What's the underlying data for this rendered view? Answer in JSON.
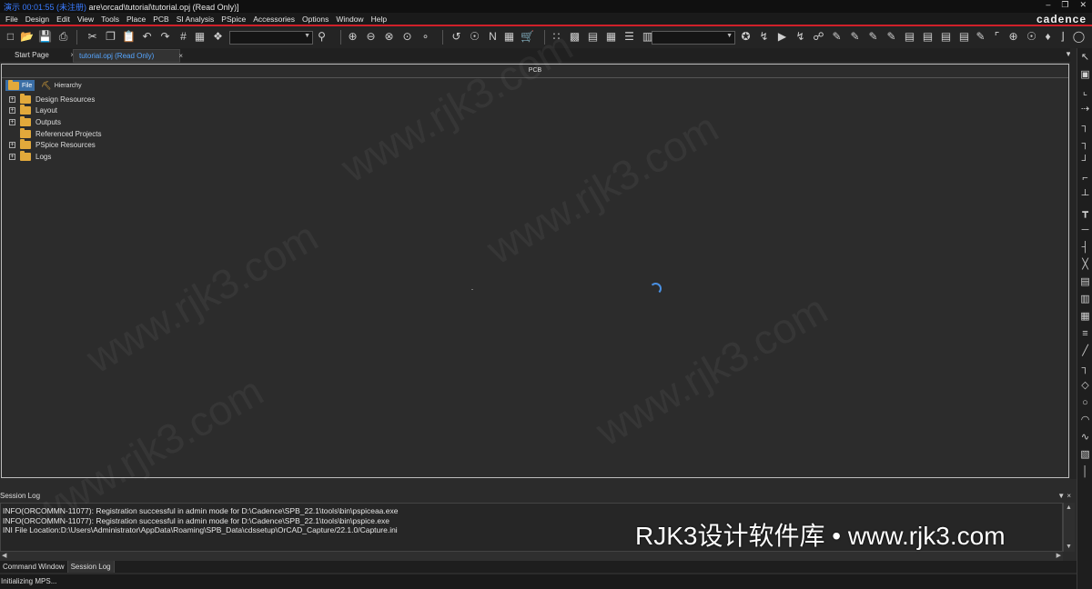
{
  "window": {
    "title": "演示 00:01:55 未注册 Capture - [...…are\\orcad\\tutorial\\tutorial.opj (Read Only)]",
    "title_overlay": "演示 00:01:55 (未注册)",
    "title_path": "are\\orcad\\tutorial\\tutorial.opj (Read Only)]",
    "brand": "cadence"
  },
  "menu": [
    "File",
    "Design",
    "Edit",
    "View",
    "Tools",
    "Place",
    "PCB",
    "SI Analysis",
    "PSpice",
    "Accessories",
    "Options",
    "Window",
    "Help"
  ],
  "tabs": {
    "start_page": "Start Page",
    "project": "tutorial.opj (Read Only)",
    "close_glyph": "×"
  },
  "project_pane": {
    "header": "PCB",
    "view_tabs": {
      "file": "File",
      "hierarchy": "Hierarchy"
    },
    "tree": [
      {
        "label": "Design Resources",
        "expandable": true
      },
      {
        "label": "Layout",
        "expandable": true
      },
      {
        "label": "Outputs",
        "expandable": true
      },
      {
        "label": "Referenced Projects",
        "expandable": false
      },
      {
        "label": "PSpice Resources",
        "expandable": true
      },
      {
        "label": "Logs",
        "expandable": true
      }
    ]
  },
  "session_log": {
    "title": "Session Log",
    "lines": [
      "INFO(ORCOMMN-11077): Registration successful in admin mode for D:\\Cadence\\SPB_22.1\\tools\\bin\\pspiceaa.exe",
      "INFO(ORCOMMN-11077): Registration successful in admin mode for D:\\Cadence\\SPB_22.1\\tools\\bin\\pspice.exe",
      "INI File Location:D:\\Users\\Administrator\\AppData\\Roaming\\SPB_Data\\cdssetup\\OrCAD_Capture/22.1.0/Capture.ini"
    ]
  },
  "bottom_tabs": [
    "Command Window",
    "Session Log"
  ],
  "status": "Initializing MPS...",
  "watermark": {
    "main": "RJK3设计软件库 • www.rjk3.com",
    "ghost": "www.rjk3.com"
  },
  "colors": {
    "accent_red": "#d0202a",
    "tab_active_text": "#56a6ff",
    "folder": "#e2a93b"
  }
}
